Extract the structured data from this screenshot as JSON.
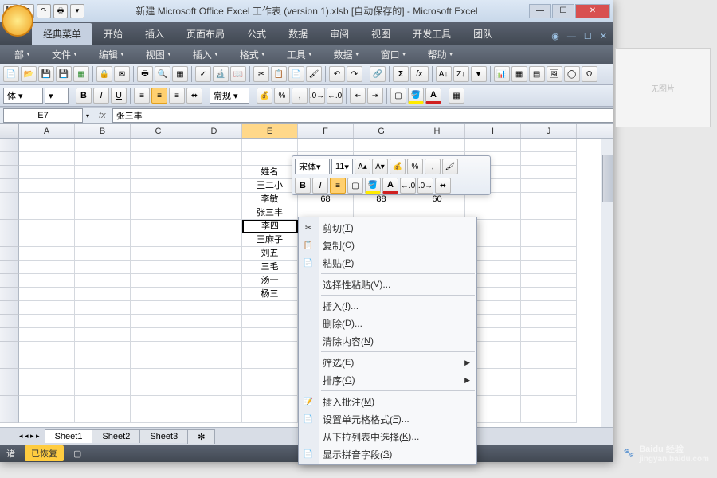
{
  "title": "新建 Microsoft Office Excel 工作表 (version 1).xlsb [自动保存的] - Microsoft Excel",
  "ribbon_tabs": [
    "经典菜单",
    "开始",
    "插入",
    "页面布局",
    "公式",
    "数据",
    "审阅",
    "视图",
    "开发工具",
    "团队"
  ],
  "menu_items": [
    "部",
    "文件",
    "编辑",
    "视图",
    "插入",
    "格式",
    "工具",
    "数据",
    "窗口",
    "帮助"
  ],
  "namebox": "E7",
  "formula": "张三丰",
  "columns": [
    "A",
    "B",
    "C",
    "D",
    "E",
    "F",
    "G",
    "H",
    "I",
    "J"
  ],
  "col_data": {
    "E": [
      "",
      "",
      "",
      "姓名",
      "王二小",
      "李敏",
      "张三丰",
      "李四",
      "王麻子",
      "刘五",
      "三毛",
      "汤一",
      "杨三"
    ],
    "F": [
      "",
      "",
      "",
      "",
      "",
      "68"
    ],
    "G": [
      "",
      "",
      "",
      "",
      "",
      "88"
    ],
    "H": [
      "",
      "",
      "",
      "",
      "",
      "60"
    ]
  },
  "selected_cell": {
    "row": 7,
    "col": "E"
  },
  "sheets": [
    "Sheet1",
    "Sheet2",
    "Sheet3"
  ],
  "status": {
    "ready": "诸",
    "recovered": "已恢复"
  },
  "mini": {
    "font": "宋体",
    "size": "11"
  },
  "context": [
    {
      "icon": "✂",
      "label": "剪切",
      "key": "T"
    },
    {
      "icon": "📋",
      "label": "复制",
      "key": "C"
    },
    {
      "icon": "📄",
      "label": "粘贴",
      "key": "P"
    },
    {
      "sep": true
    },
    {
      "label": "选择性粘贴",
      "key": "V",
      "suffix": "..."
    },
    {
      "sep": true
    },
    {
      "label": "插入",
      "key": "I",
      "suffix": "..."
    },
    {
      "label": "删除",
      "key": "D",
      "suffix": "..."
    },
    {
      "label": "清除内容",
      "key": "N"
    },
    {
      "sep": true
    },
    {
      "label": "筛选",
      "key": "E",
      "arrow": true
    },
    {
      "label": "排序",
      "key": "O",
      "arrow": true
    },
    {
      "sep": true
    },
    {
      "icon": "📝",
      "label": "插入批注",
      "key": "M"
    },
    {
      "icon": "�formats",
      "label": "设置单元格格式",
      "key": "F",
      "suffix": "..."
    },
    {
      "label": "从下拉列表中选择",
      "key": "K",
      "suffix": "..."
    },
    {
      "icon": "wén",
      "label": "显示拼音字段",
      "key": "S"
    }
  ],
  "side_placeholder": "无图片",
  "watermark": {
    "brand": "Baidu 经验",
    "url": "jingyan.baidu.com"
  }
}
